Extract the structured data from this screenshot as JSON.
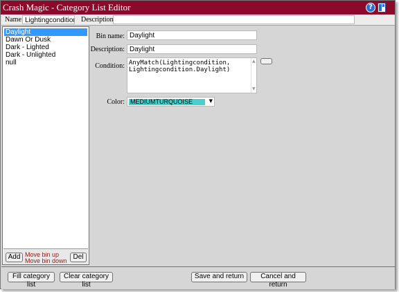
{
  "window": {
    "title": "Crash Magic - Category List Editor"
  },
  "header": {
    "name_label": "Name:",
    "name_value": "Lightingcondition",
    "description_label": "Description:",
    "description_value": ""
  },
  "bins": {
    "items": [
      "Daylight",
      "Dawn Or Dusk",
      "Dark - Lighted",
      "Dark - Unlighted",
      "null"
    ],
    "selected_index": 0,
    "add_label": "Add",
    "move_up_label": "Move bin up",
    "move_down_label": "Move bin down",
    "del_label": "Del"
  },
  "form": {
    "bin_name_label": "Bin name:",
    "bin_name_value": "Daylight",
    "description_label": "Description:",
    "description_value": "Daylight",
    "condition_label": "Condition:",
    "condition_line1": "AnyMatch(Lightingcondition,",
    "condition_line2": "Lightingcondition.Daylight)",
    "color_label": "Color:",
    "color_value": "MEDIUMTURQUOISE",
    "color_swatch": "#48d1cc"
  },
  "footer": {
    "fill_label": "Fill category list",
    "clear_label": "Clear category list",
    "save_label": "Save and return",
    "cancel_label": "Cancel and return"
  },
  "colors": {
    "titlebar": "#8b0a2b",
    "selection": "#3399ff",
    "move_link": "#8b1a1a"
  }
}
